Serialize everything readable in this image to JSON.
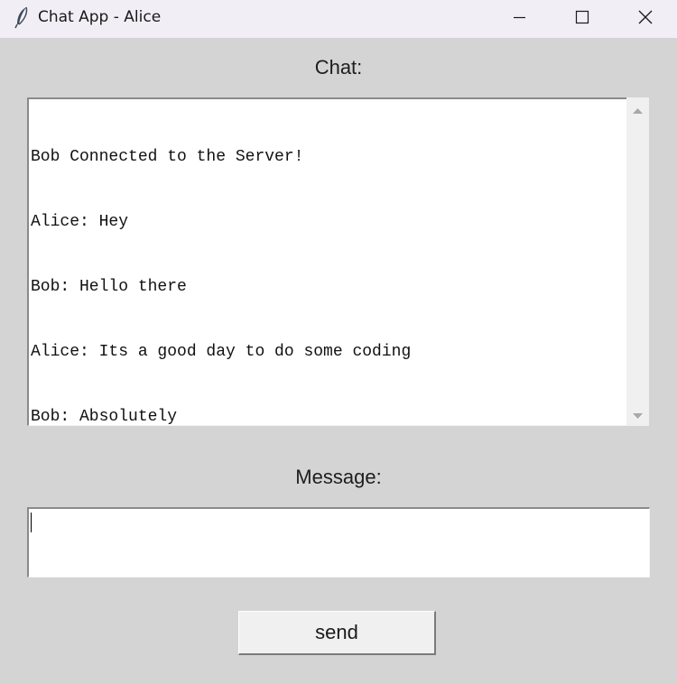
{
  "window": {
    "title": "Chat App - Alice",
    "icon": "feather-icon",
    "controls": [
      "minimize-icon",
      "maximize-icon",
      "close-icon"
    ]
  },
  "chat": {
    "label": "Chat:",
    "lines": [
      "Bob Connected to the Server!",
      "Alice: Hey",
      "Bob: Hello there",
      "Alice: Its a good day to do some coding",
      "Bob: Absolutely"
    ]
  },
  "message": {
    "label": "Message:",
    "value": ""
  },
  "send_button": {
    "label": "send"
  },
  "colors": {
    "background": "#d4d4d4",
    "titlebar": "#f1eef6",
    "text_area": "#ffffff",
    "button_face": "#f0f0f0"
  }
}
